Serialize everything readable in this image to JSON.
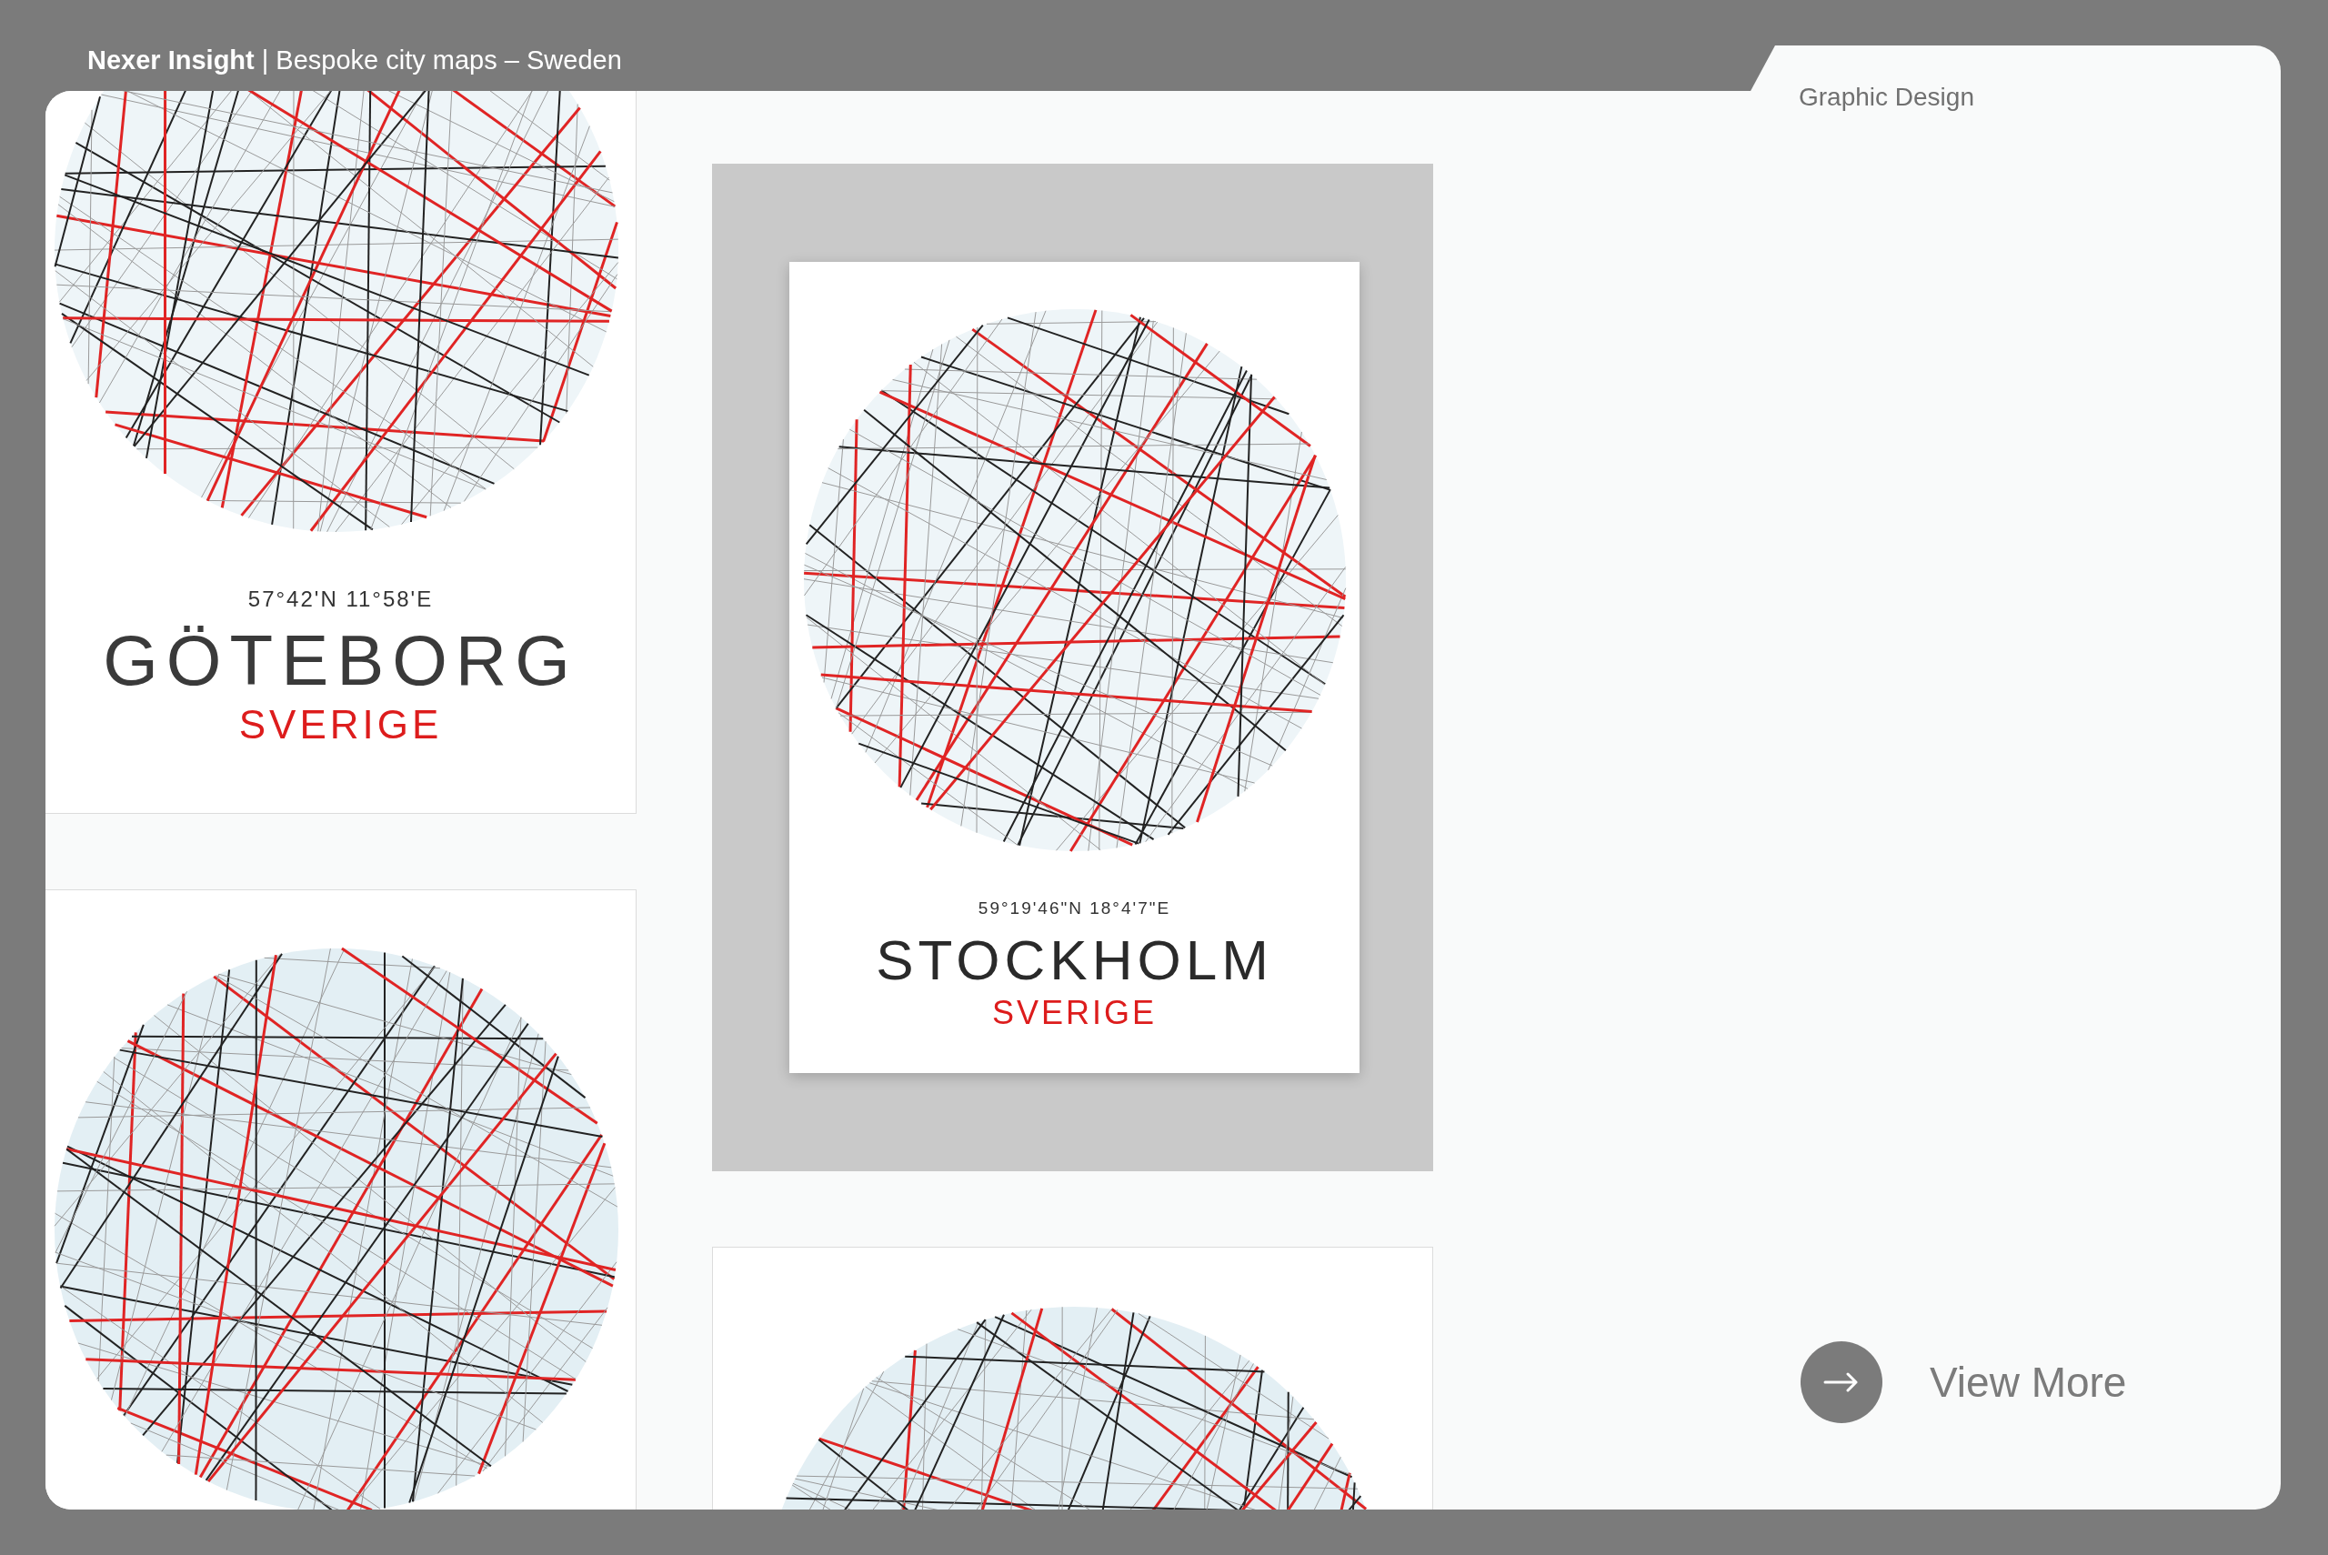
{
  "header": {
    "title": "**Nexer Insight** | Bespoke city maps – Sweden"
  },
  "category_tab": {
    "label": "Graphic Design"
  },
  "columns": [
    {
      "posters": [
        {
          "kind": "flat",
          "coordinates": "57°42'N 11°58'E",
          "city": "GÖTEBORG",
          "country": "SVERIGE"
        },
        {
          "kind": "map"
        }
      ]
    },
    {
      "posters": [
        {
          "kind": "mockup",
          "coordinates": "59°19'46\"N 18°4'7\"E",
          "city": "STOCKHOLM",
          "country": "SVERIGE"
        },
        {
          "kind": "map"
        }
      ]
    }
  ],
  "view_more": {
    "label": "View More"
  }
}
